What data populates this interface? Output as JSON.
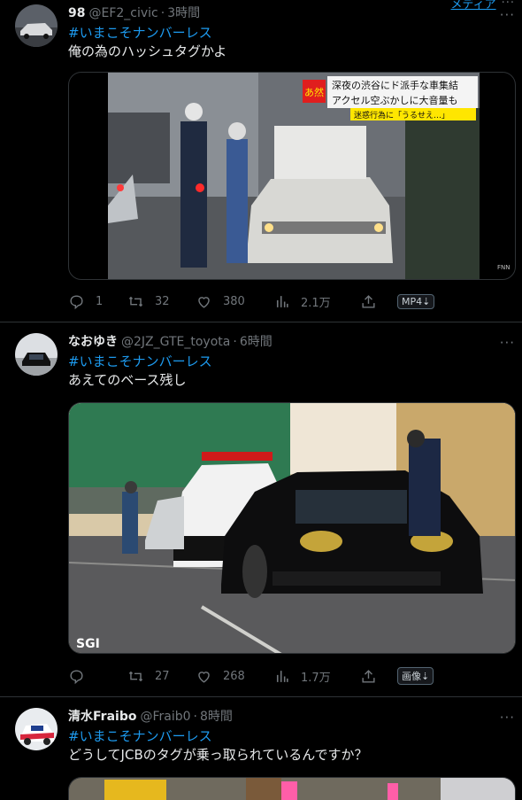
{
  "topbar": {
    "label": "メディア",
    "more": "···"
  },
  "tweets": [
    {
      "name": "98",
      "handle": "@EF2_civic",
      "time": "3時間",
      "hashtag": "#いまこそナンバーレス",
      "text": "俺の為のハッシュタグかよ",
      "media": {
        "caption_top": "深夜の渋谷にド派手な車集結",
        "caption_mid": "アクセル空ぶかしに大音量も",
        "caption_bot": "迷惑行為に「うるせえ…」",
        "corner": "あ然",
        "watermark": "FNN"
      },
      "stats": {
        "reply": "1",
        "retweet": "32",
        "like": "380",
        "views": "2.1万",
        "badge": "MP4⇣"
      }
    },
    {
      "name": "なおゆき",
      "handle": "@2JZ_GTE_toyota",
      "time": "6時間",
      "hashtag": "#いまこそナンバーレス",
      "text": "あえてのベース残し",
      "media": {
        "watermark": "SGI"
      },
      "stats": {
        "reply": "",
        "retweet": "27",
        "like": "268",
        "views": "1.7万",
        "badge": "画像⇣"
      }
    },
    {
      "name": "清水Fraibo",
      "handle": "@Fraib0",
      "time": "8時間",
      "hashtag": "#いまこそナンバーレス",
      "text": "どうしてJCBのタグが乗っ取られているんですか？"
    }
  ],
  "sep": "·",
  "more": "···",
  "colors": {
    "accent": "#1d9bf0",
    "muted": "#71767b",
    "bg": "#000000",
    "border": "#2f3336"
  }
}
